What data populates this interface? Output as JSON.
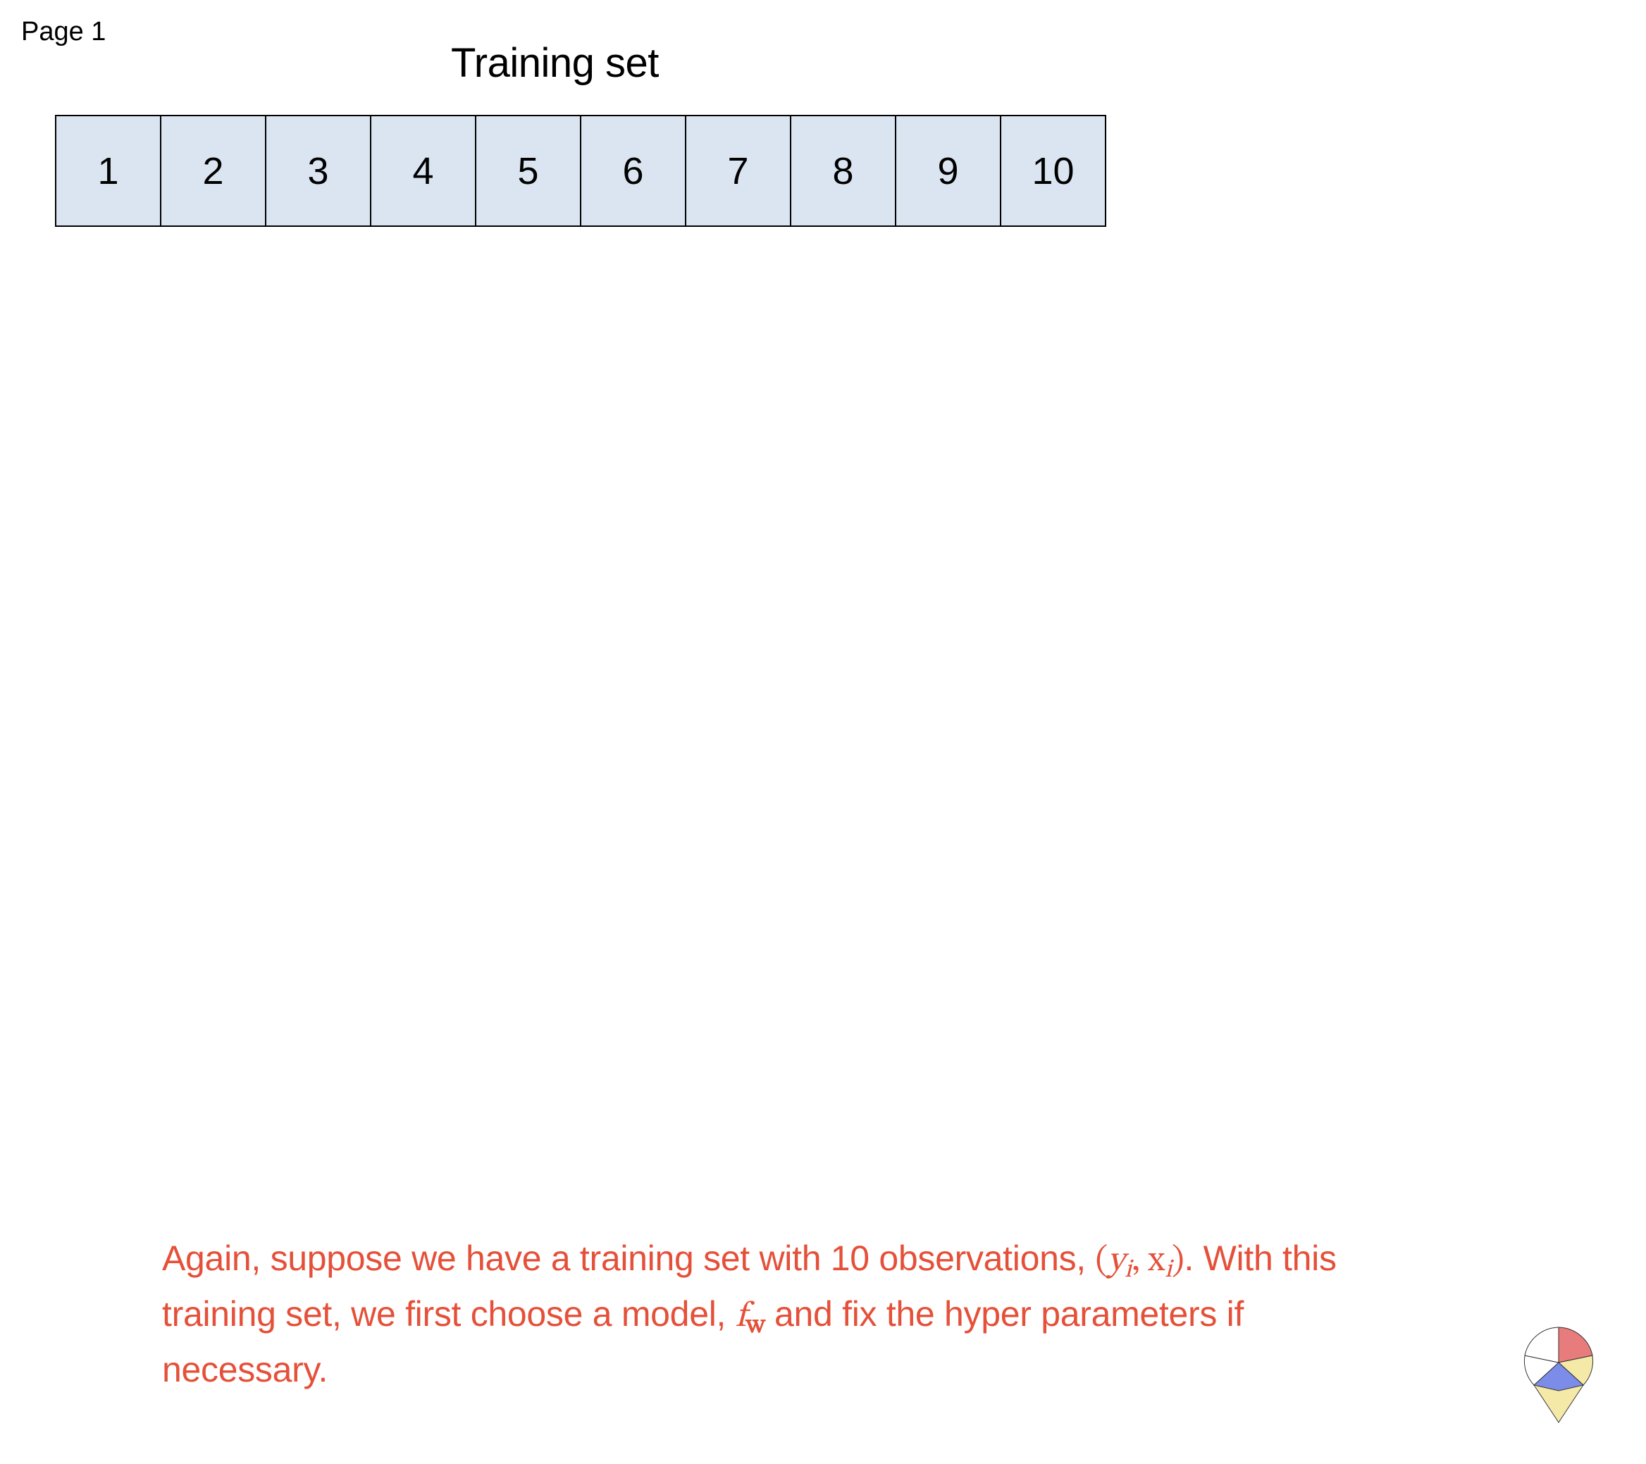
{
  "page_label": "Page 1",
  "heading": "Training set",
  "cells": [
    "1",
    "2",
    "3",
    "4",
    "5",
    "6",
    "7",
    "8",
    "9",
    "10"
  ],
  "caption": {
    "part1": "Again, suppose we have a training set with 10 observations, ",
    "lparen": "(",
    "y": "y",
    "yi": "i",
    "comma": ", ",
    "x": "x",
    "xi": "i",
    "rparen": ")",
    "period1": ". ",
    "part2": "With this training set, we first choose a model, ",
    "f": "f",
    "fw": "w",
    "part3": " and fix the hyper parameters if necessary."
  }
}
